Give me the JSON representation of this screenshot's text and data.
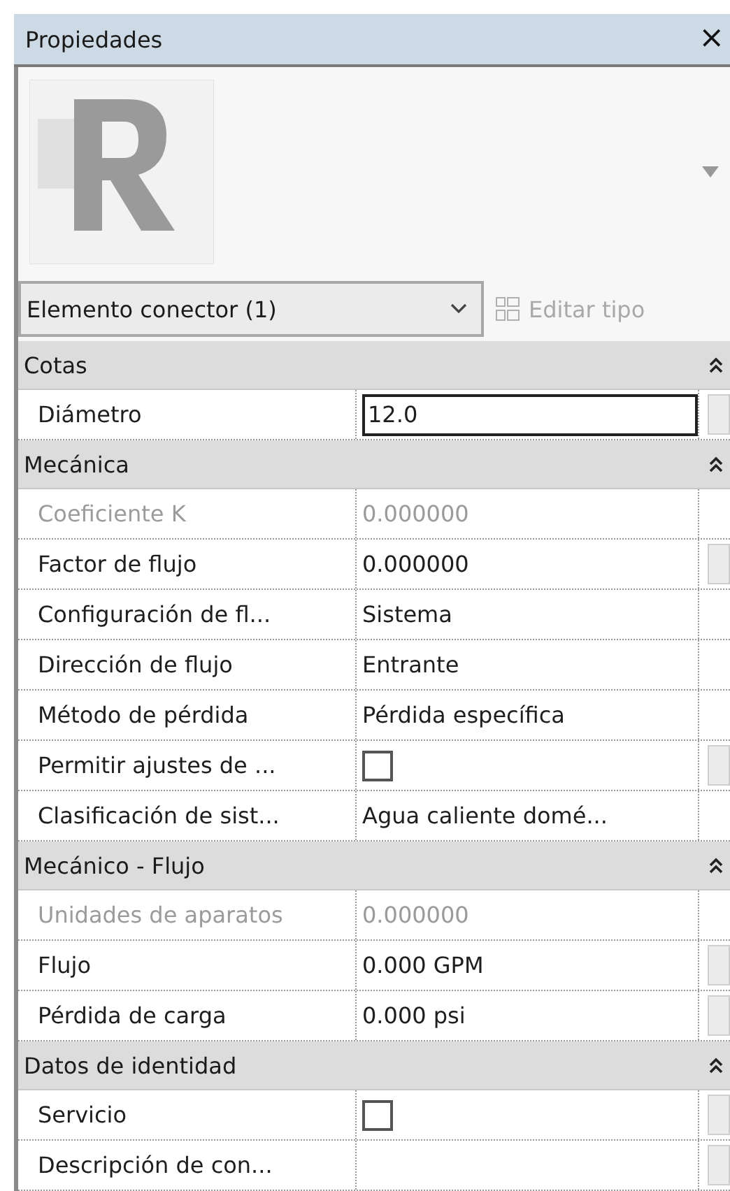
{
  "window": {
    "title": "Propiedades",
    "close": "×"
  },
  "type_selector": {
    "value": "Elemento conector (1)"
  },
  "edit_type": {
    "label": "Editar tipo",
    "disabled": true
  },
  "groups": [
    {
      "title": "Cotas",
      "expanded": true,
      "rows": [
        {
          "label": "Diámetro",
          "value": "12.0",
          "kind": "field",
          "disabled": false,
          "has_button": true
        }
      ]
    },
    {
      "title": "Mecánica",
      "expanded": true,
      "rows": [
        {
          "label": "Coeficiente K",
          "value": "0.000000",
          "kind": "text",
          "disabled": true,
          "has_button": false
        },
        {
          "label": "Factor de flujo",
          "value": "0.000000",
          "kind": "text",
          "disabled": false,
          "has_button": true
        },
        {
          "label": "Configuración de fl...",
          "value": "Sistema",
          "kind": "text",
          "disabled": false,
          "has_button": false
        },
        {
          "label": "Dirección de flujo",
          "value": "Entrante",
          "kind": "text",
          "disabled": false,
          "has_button": false
        },
        {
          "label": "Método de pérdida",
          "value": "Pérdida específica",
          "kind": "text",
          "disabled": false,
          "has_button": false
        },
        {
          "label": "Permitir ajustes de ...",
          "checked": false,
          "kind": "checkbox",
          "disabled": false,
          "has_button": true
        },
        {
          "label": "Clasificación de sist...",
          "value": "Agua caliente domé...",
          "kind": "text",
          "disabled": false,
          "has_button": false
        }
      ]
    },
    {
      "title": "Mecánico - Flujo",
      "expanded": true,
      "rows": [
        {
          "label": "Unidades de aparatos",
          "value": "0.000000",
          "kind": "text",
          "disabled": true,
          "has_button": false
        },
        {
          "label": "Flujo",
          "value": "0.000 GPM",
          "kind": "text",
          "disabled": false,
          "has_button": true
        },
        {
          "label": "Pérdida de carga",
          "value": "0.000 psi",
          "kind": "text",
          "disabled": false,
          "has_button": true
        }
      ]
    },
    {
      "title": "Datos de identidad",
      "expanded": true,
      "rows": [
        {
          "label": "Servicio",
          "checked": false,
          "kind": "checkbox",
          "disabled": false,
          "has_button": true
        },
        {
          "label": "Descripción de con...",
          "kind": "text",
          "disabled": false,
          "has_button": true
        }
      ]
    }
  ]
}
